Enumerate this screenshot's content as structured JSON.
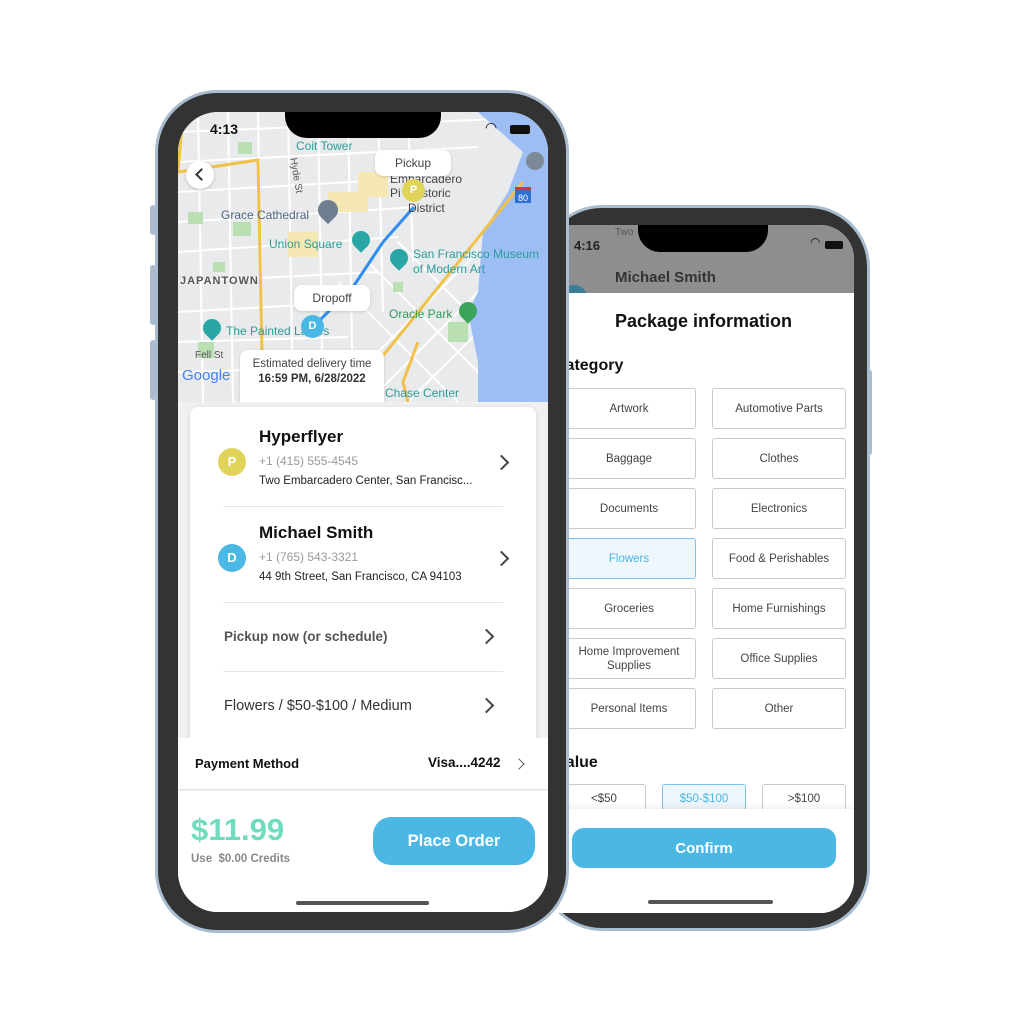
{
  "left_phone": {
    "status_time": "4:13",
    "map": {
      "labels": {
        "grace": "Grace Cathedral",
        "union": "Union Square",
        "sfmoma1": "San Francisco Museum",
        "sfmoma2": "of Modern Art",
        "japantown": "JAPANTOWN",
        "oracle": "Oracle Park",
        "painted": "The Painted Ladies",
        "embarcadero1": "Embarcadero",
        "embarcadero2": "Pi   Historic",
        "embarcadero3": "District",
        "hyde": "Hyde St",
        "fell": "Fell St",
        "chase": "Chase Center",
        "coit": "Coit Tower",
        "i80": "80",
        "google": "Google"
      },
      "pickup_label": "Pickup",
      "dropoff_label": "Dropoff",
      "pickup_marker": "P",
      "dropoff_marker": "D",
      "eta_label": "Estimated delivery time",
      "eta_value": "16:59 PM, 6/28/2022"
    },
    "pickup": {
      "avatar": "P",
      "name": "Hyperflyer",
      "phone": "+1 (415) 555-4545",
      "address": "Two Embarcadero Center, San Francisc..."
    },
    "dropoff": {
      "avatar": "D",
      "name": "Michael Smith",
      "phone": "+1 (765) 543-3321",
      "address": "44 9th Street, San Francisco, CA 94103"
    },
    "schedule": "Pickup now (or schedule)",
    "package_summary": "Flowers / $50-$100 / Medium",
    "payment": {
      "label": "Payment Method",
      "value": "Visa....4242"
    },
    "price": "$11.99",
    "credits": "Use  $0.00 Credits",
    "place_order": "Place Order"
  },
  "right_phone": {
    "status_time": "4:16",
    "bg_name": "Michael Smith",
    "bg_snippet": "Two                              ncisc...",
    "title": "Package information",
    "category_label": "Category",
    "categories": [
      {
        "label": "Artwork",
        "selected": false
      },
      {
        "label": "Automotive Parts",
        "selected": false
      },
      {
        "label": "Baggage",
        "selected": false
      },
      {
        "label": "Clothes",
        "selected": false
      },
      {
        "label": "Documents",
        "selected": false
      },
      {
        "label": "Electronics",
        "selected": false
      },
      {
        "label": "Flowers",
        "selected": true
      },
      {
        "label": "Food & Perishables",
        "selected": false
      },
      {
        "label": "Groceries",
        "selected": false
      },
      {
        "label": "Home Furnishings",
        "selected": false
      },
      {
        "label": "Home Improvement Supplies",
        "selected": false
      },
      {
        "label": "Office Supplies",
        "selected": false
      },
      {
        "label": "Personal Items",
        "selected": false
      },
      {
        "label": "Other",
        "selected": false
      }
    ],
    "value_label": "Value",
    "values": [
      {
        "label": "<$50",
        "selected": false
      },
      {
        "label": "$50-$100",
        "selected": true
      },
      {
        "label": ">$100",
        "selected": false
      }
    ],
    "confirm": "Confirm"
  },
  "colors": {
    "accent": "#4bb7e5",
    "price": "#6fdcc0",
    "pickup": "#e0d35a",
    "dropoff": "#4bb7e5",
    "frame": "#a9bcd0"
  }
}
